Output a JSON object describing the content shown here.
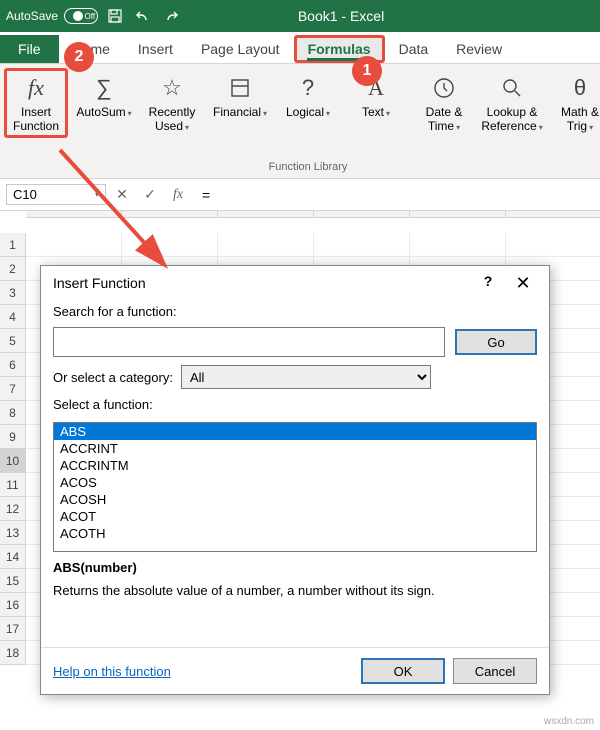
{
  "titlebar": {
    "autosave": "AutoSave",
    "toggle": "Off",
    "title": "Book1 - Excel"
  },
  "tabs": {
    "file": "File",
    "home": "Home",
    "insert": "Insert",
    "pagelayout": "Page Layout",
    "formulas": "Formulas",
    "data": "Data",
    "review": "Review"
  },
  "ribbon": {
    "insert_function": "Insert\nFunction",
    "autosum": "AutoSum",
    "recently": "Recently\nUsed",
    "financial": "Financial",
    "logical": "Logical",
    "text": "Text",
    "date_time": "Date &\nTime",
    "lookup": "Lookup &\nReference",
    "math": "Math &\nTrig",
    "group_label": "Function Library"
  },
  "fbar": {
    "cell": "C10",
    "formula": "="
  },
  "dialog": {
    "title": "Insert Function",
    "search_lbl": "Search for a function:",
    "search_val": "",
    "go": "Go",
    "cat_lbl": "Or select a category:",
    "cat_val": "All",
    "sel_lbl": "Select a function:",
    "fns": [
      "ABS",
      "ACCRINT",
      "ACCRINTM",
      "ACOS",
      "ACOSH",
      "ACOT",
      "ACOTH"
    ],
    "sig": "ABS(number)",
    "desc": "Returns the absolute value of a number, a number without its sign.",
    "help": "Help on this function",
    "ok": "OK",
    "cancel": "Cancel"
  },
  "annotations": {
    "one": "1",
    "two": "2"
  },
  "watermark": "wsxdn.com"
}
